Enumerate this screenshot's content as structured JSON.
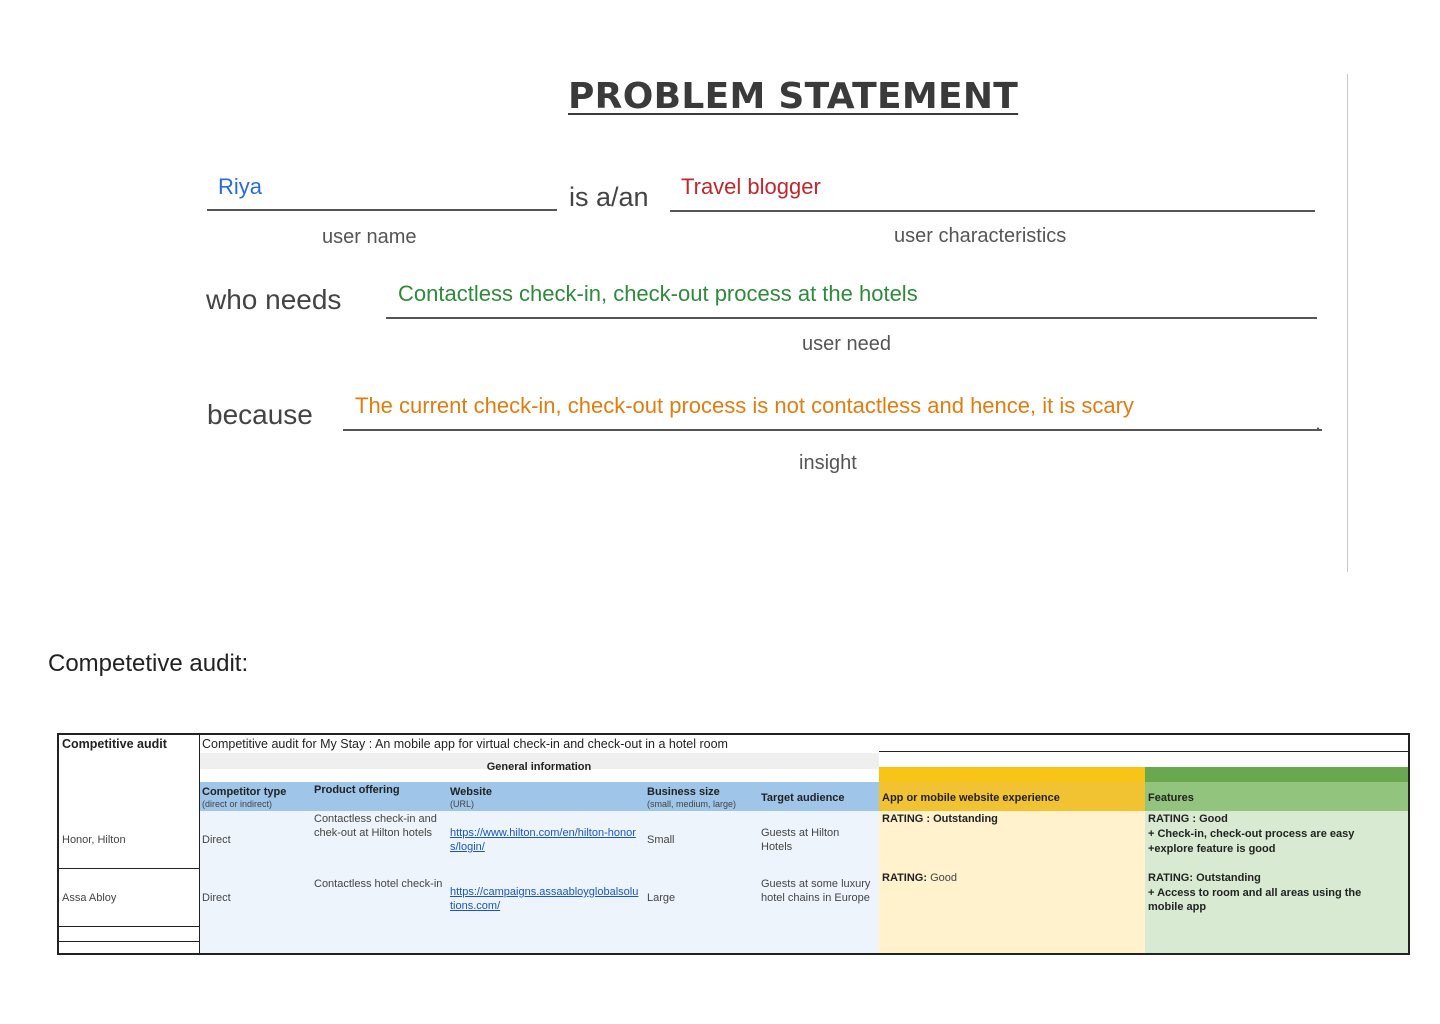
{
  "problem_statement": {
    "title": "PROBLEM STATEMENT",
    "user_name": "Riya",
    "is_a": "is a/an",
    "user_characteristics": "Travel blogger",
    "caption_user_name": "user name",
    "caption_user_characteristics": "user characteristics",
    "who_needs": "who needs",
    "user_need": "Contactless check-in, check-out process at the hotels",
    "caption_user_need": "user need",
    "because": "because",
    "insight": "The current check-in, check-out process is not contactless and hence, it is scary",
    "period": ".",
    "caption_insight": "insight"
  },
  "audit_heading": "Competetive audit:",
  "audit_table": {
    "corner_label": "Competitive audit",
    "caption": "Competitive audit for My Stay : An mobile app for virtual check-in and check-out in a hotel room",
    "group_header": "General information",
    "headers": {
      "competitor_type": "Competitor type",
      "competitor_type_sub": "(direct or indirect)",
      "product_offering": "Product offering",
      "website": "Website",
      "website_sub": "(URL)",
      "business_size": "Business size",
      "business_size_sub": "(small, medium, large)",
      "target_audience": "Target audience",
      "app_experience": "App or mobile website experience",
      "features": "Features"
    },
    "rows": [
      {
        "name": "Honor, Hilton",
        "type": "Direct",
        "offering": "Contactless check-in and chek-out at Hilton hotels",
        "website": "https://www.hilton.com/en/hilton-honors/login/",
        "size": "Small",
        "audience": "Guests at Hilton Hotels",
        "experience_label": "RATING : Outstanding",
        "experience_value": "",
        "features_rating": "RATING : Good",
        "features_line1": "+ Check-in, check-out process are easy",
        "features_line2": "+explore feature is good"
      },
      {
        "name": "Assa Abloy",
        "type": "Direct",
        "offering": "Contactless hotel check-in",
        "website": "https://campaigns.assaabloyglobalsolutions.com/",
        "size": "Large",
        "audience": "Guests at some luxury hotel chains in Europe",
        "experience_label": "RATING:",
        "experience_value": " Good",
        "features_rating": "RATING: Outstanding",
        "features_line1": "+ Access to room and all areas using the mobile app",
        "features_line2": ""
      }
    ]
  },
  "colors": {
    "user_name": "#2a6bd4",
    "user_characteristics": "#c0282d",
    "user_need": "#2e8b3a",
    "insight": "#e07d10",
    "general_header_bg": "#9fc5e8",
    "general_body_bg": "#eef4fb",
    "experience_header_bg": "#f1c232",
    "experience_body_bg": "#fff2cc",
    "features_header_bg": "#93c47d",
    "features_body_bg": "#d9ead3"
  }
}
